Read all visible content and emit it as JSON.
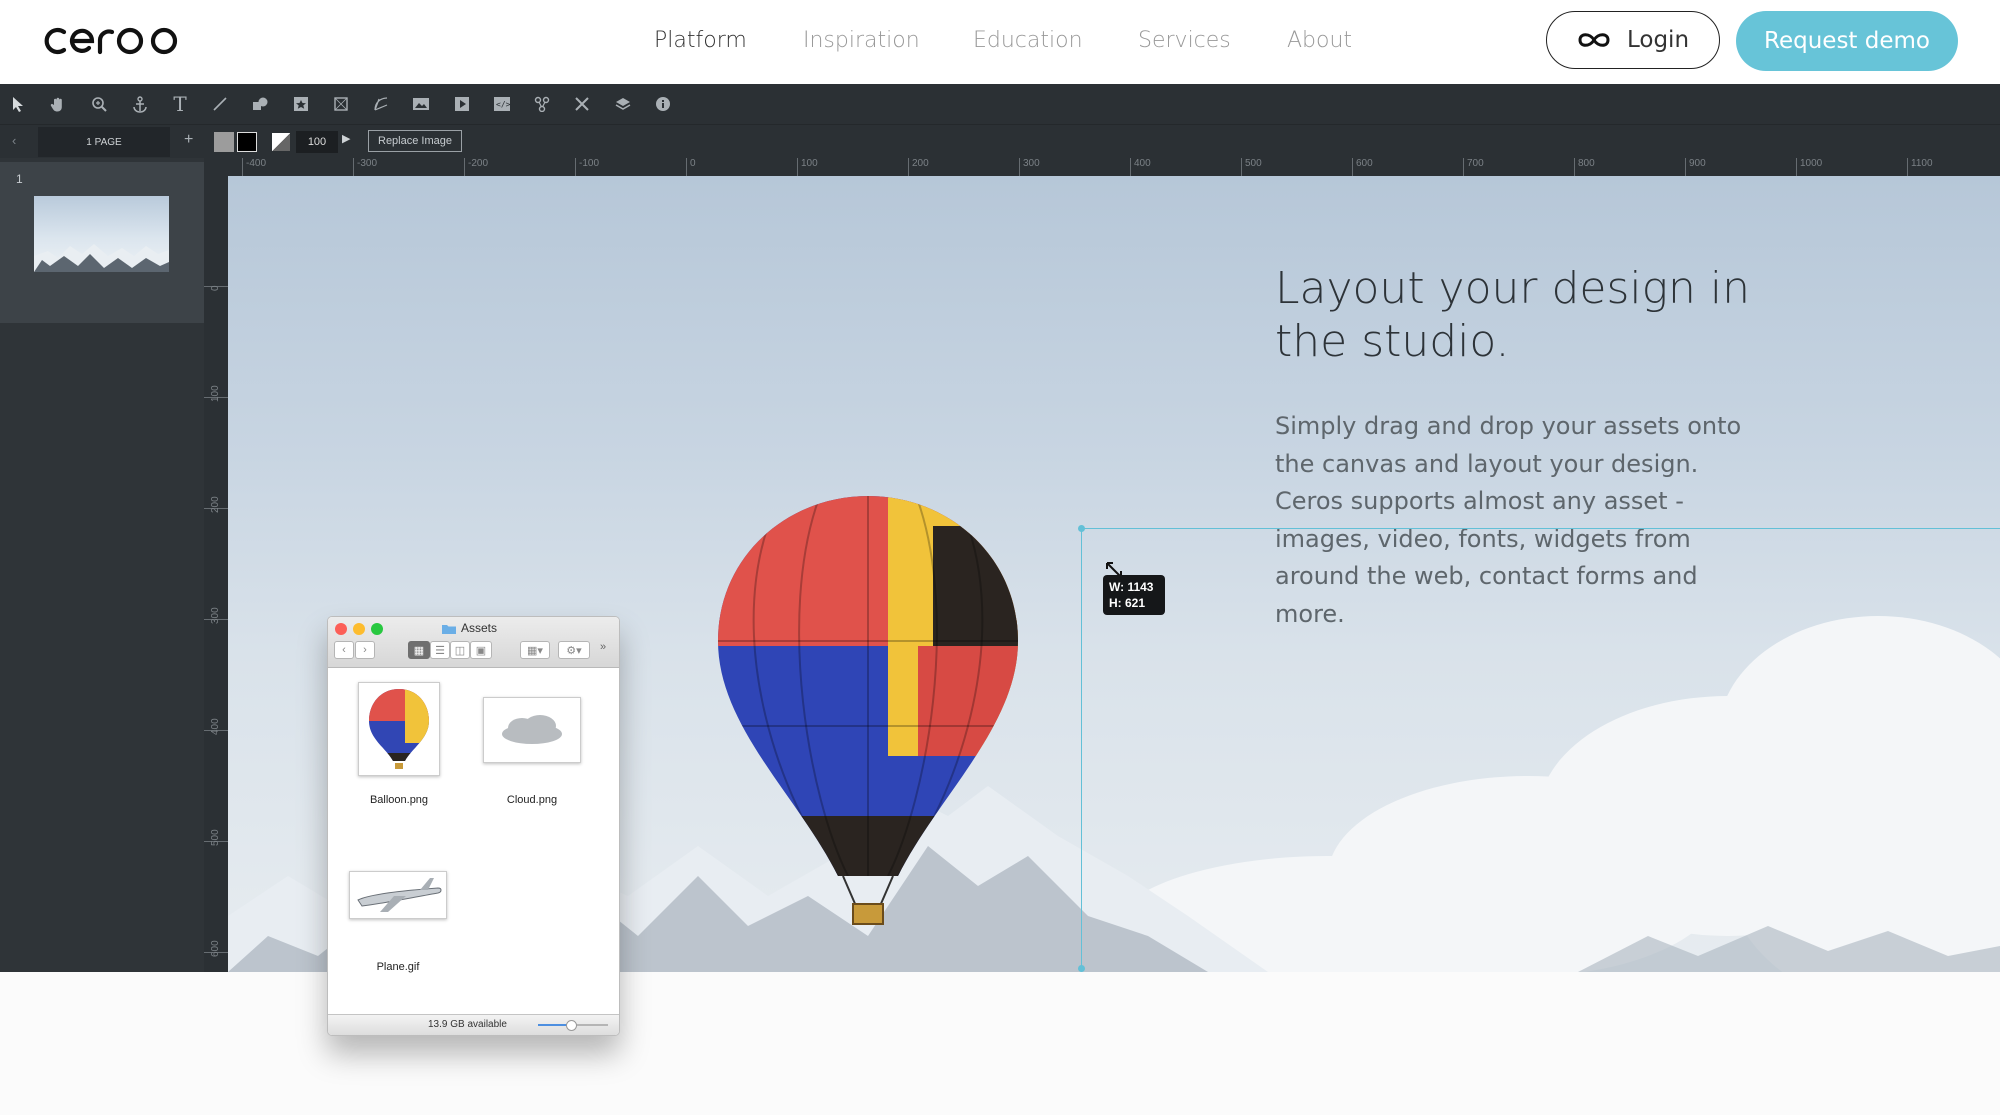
{
  "header": {
    "logo_text": "ceros",
    "nav": [
      "Platform",
      "Inspiration",
      "Education",
      "Services",
      "About"
    ],
    "login_label": "Login",
    "demo_label": "Request demo"
  },
  "toolbar": {
    "tools": [
      "select-arrow-icon",
      "hand-icon",
      "zoom-icon",
      "anchor-icon",
      "text-icon",
      "line-icon",
      "shapes-icon",
      "image-placeholder-icon",
      "frame-icon",
      "svg-path-icon",
      "image-icon",
      "video-icon",
      "embed-icon",
      "hotspot-icon",
      "crop-tools-icon",
      "layers-icon",
      "info-icon"
    ]
  },
  "subbar": {
    "pages_label": "1 PAGE",
    "add_label": "+",
    "zoom_value": "100",
    "replace_label": "Replace Image"
  },
  "pages": {
    "page_number": "1"
  },
  "ruler": {
    "top_labels": [
      "-400",
      "-300",
      "-200",
      "-100",
      "0",
      "100",
      "200",
      "300",
      "400",
      "500",
      "600",
      "700",
      "800",
      "900",
      "1000",
      "1100"
    ],
    "left_labels": [
      "0",
      "100",
      "200",
      "300",
      "400",
      "500",
      "600"
    ]
  },
  "canvas": {
    "headline": "Layout your design in the studio.",
    "body": "Simply drag and drop your assets onto the canvas and layout your design. Ceros supports almost any asset - images, video, fonts, widgets from around the web, contact forms and more.",
    "dim_w": "W: 1143",
    "dim_h": "H: 621"
  },
  "finder": {
    "title": "Assets",
    "assets": [
      "Balloon.png",
      "Cloud.png",
      "Plane.gif"
    ],
    "footer": "13.9 GB available"
  },
  "colors": {
    "accent": "#67c4d8",
    "chrome": "#2b3034",
    "selection": "#63c0d7"
  }
}
